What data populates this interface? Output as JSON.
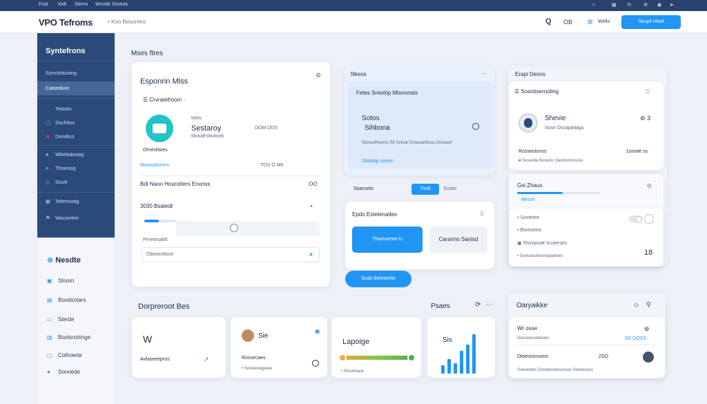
{
  "topstrip": {
    "items": [
      "Fust",
      "Kelt",
      "Sterra",
      "Wrostir Sestuts"
    ]
  },
  "header": {
    "logo": "VPO Tefroms",
    "crumb": "• Koo Besontes",
    "actions": {
      "search_glyph": "Q",
      "user_initials": "OB",
      "wave_label": "Wello",
      "primary_button": "Seupil Hinel"
    }
  },
  "sidebar": {
    "title": "Syntefrons",
    "items": [
      {
        "label": "Syncttotsoing",
        "icon": ""
      },
      {
        "label": "Caisedunt",
        "icon": ""
      },
      {
        "label": "Tottoks",
        "icon": "·"
      },
      {
        "label": "Sschitos",
        "icon": "▢"
      },
      {
        "label": "Deodico",
        "icon": "★"
      },
      {
        "label": "Wkeliaboatg",
        "icon": "●"
      },
      {
        "label": "Thoenog",
        "icon": "■"
      },
      {
        "label": "Soutl",
        "icon": "◇"
      },
      {
        "label": "Teferinotig",
        "icon": "▣"
      },
      {
        "label": "Wausettre",
        "icon": "⚑"
      }
    ]
  },
  "sidebar_light": {
    "title": "Nesdte",
    "items": [
      {
        "label": "Stoom",
        "icon": "▣"
      },
      {
        "label": "Boodsotars",
        "icon": "▤"
      },
      {
        "label": "Sterde",
        "icon": "▭"
      },
      {
        "label": "Boolsrotringe",
        "icon": "▥"
      },
      {
        "label": "Colhoerte",
        "icon": "▢"
      },
      {
        "label": "Sonoede",
        "icon": "●"
      }
    ]
  },
  "main": {
    "section_title": "Mses ftres"
  },
  "card1": {
    "title": "Esponrin Mlss",
    "sub": "Crvratefroom",
    "app_name": "Sestaroy",
    "app_meta": "Mosafrsttoitods",
    "app_num": "DOM DDS",
    "app_prefix": "Mels",
    "label_a": "Ornecktoes",
    "link": "Mossuteorms",
    "link_meta": "TOS O MK",
    "row1": "Bdl Naoo Hourotters Enonss",
    "row1_badge": "OO",
    "row2": "3030 Bsatedt",
    "row2_badge": "⏸",
    "progress": 0.45,
    "input_label": "Peretesatltt",
    "input_value": "Obeosstitoot"
  },
  "card2": {
    "title": "Nkeos",
    "feature_title": "Fetes Sreotrip Mtsnonsts",
    "feature_line1": "Sotos",
    "feature_line2": "Sihbona",
    "feature_desc": "Stoseothoeros Stt Setoat Dvoeaattilloos Doneaet",
    "feature_link": "Dtotabp sooos",
    "tab_label": "Soacsets",
    "tab_active": "Tvolt",
    "tab_extra": "Scatio"
  },
  "card3": {
    "title": "Epdo Estetenatles",
    "btn_primary": "Tfoamoeste ls",
    "btn_secondary": "Carsnno Sanisd",
    "cta": "Scab Betesertte"
  },
  "col3": {
    "title": "Erapi Deons",
    "profile_header": "Sosntiserooling",
    "profile_name": "Shevie",
    "profile_sub": "Sose Dscapattags",
    "profile_num": "3",
    "row_label": "Rosseutonss",
    "row_value": "1sisote ss",
    "row_meta": "Seseolie Boserto Oesttonmssoss",
    "mid_title": "Gsi Zhaus",
    "mid_link": "Mesnt",
    "mid_rows": [
      "Sostetee",
      "Bloeootos",
      "Teiyopsatt Scotieses",
      "Gerlsassttoonlspaetoes"
    ],
    "mid_num": "18",
    "progress": 0.55
  },
  "bottom": {
    "section_title": "Dorpreroot Bes",
    "right_section": "Psaes",
    "kpi1": {
      "value": "W",
      "label": "Avfaseeepros"
    },
    "kpi2": {
      "value": "Sie",
      "label": "Rossecaes",
      "meta": "• Sesteerelgetee"
    },
    "kpi3": {
      "value": "Lapoige",
      "meta": "• Stsotboaot"
    },
    "kpi4": {
      "value": "Sis"
    },
    "summary": {
      "title": "Oaryaikke",
      "r1": "Wr osse",
      "r1_sub": "Ssoveenooteneis",
      "r1_val": "SS DOSS",
      "r2": "Dtoeotoosotos",
      "r2_val": "2SO",
      "footer": "Sseneotes Dosotesstesooses Sesesooss"
    }
  },
  "kpi4_chart": {
    "values": [
      0.2,
      0.35,
      0.25,
      0.55,
      0.7,
      0.95
    ]
  },
  "colors": {
    "accent": "#2195f3",
    "sidebar": "#2b4a7a",
    "bg": "#edf0f6"
  }
}
